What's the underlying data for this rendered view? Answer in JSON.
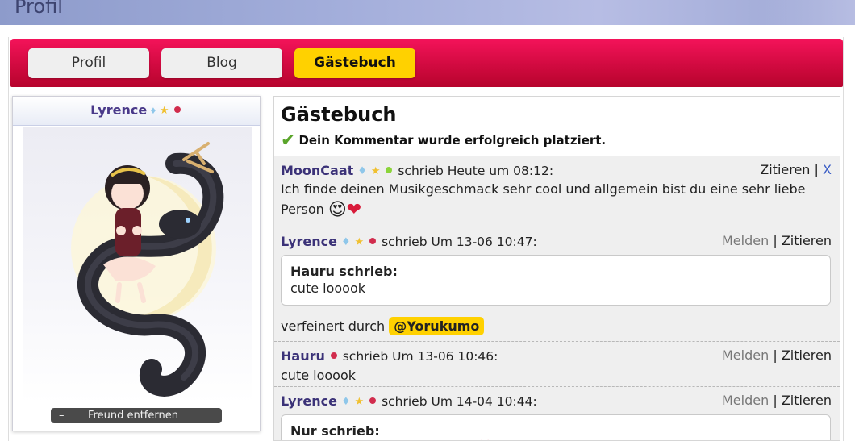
{
  "page": {
    "title": "Profil"
  },
  "tabs": [
    {
      "label": "Profil",
      "active": false
    },
    {
      "label": "Blog",
      "active": false
    },
    {
      "label": "Gästebuch",
      "active": true
    }
  ],
  "profile": {
    "name": "Lyrence",
    "remove_friend_icon": "–",
    "remove_friend_label": "Freund entfernen"
  },
  "guestbook": {
    "title": "Gästebuch",
    "success_message": "Dein Kommentar wurde erfolgreich platziert.",
    "entries": [
      {
        "user": "MoonCaat",
        "status": "online",
        "meta": "schrieb Heute um 08:12:",
        "actions": [
          "Zitieren",
          "|",
          "X"
        ],
        "text": "Ich finde deinen Musikgeschmack sehr cool und allgemein bist du eine sehr liebe Person"
      },
      {
        "user": "Lyrence",
        "status": "offline",
        "meta": "schrieb Um 13-06 10:47:",
        "actions": [
          "Melden",
          "|",
          "Zitieren"
        ],
        "quote_title": "Hauru schrieb:",
        "quote_text": "cute looook",
        "refined_prefix": "verfeinert durch",
        "mention": "@Yorukumo"
      },
      {
        "user": "Hauru",
        "status": "offline",
        "meta": "schrieb Um 13-06 10:46:",
        "actions": [
          "Melden",
          "|",
          "Zitieren"
        ],
        "text": "cute looook"
      },
      {
        "user": "Lyrence",
        "status": "offline",
        "meta": "schrieb Um 14-04 10:44:",
        "actions": [
          "Melden",
          "|",
          "Zitieren"
        ],
        "quote_title": "Nur schrieb:"
      }
    ]
  },
  "icons": {
    "diamond": "diamond-badge-icon",
    "star": "star-badge-icon",
    "status": "status-dot-icon",
    "check": "check-icon",
    "emojis": [
      "heart-eyes-emoji",
      "heart-emoji"
    ]
  },
  "colors": {
    "tabbar": "#d10a40",
    "active_tab": "#ffd100",
    "username": "#3b3278",
    "online": "#8bd43a",
    "offline": "#d12c4d"
  }
}
